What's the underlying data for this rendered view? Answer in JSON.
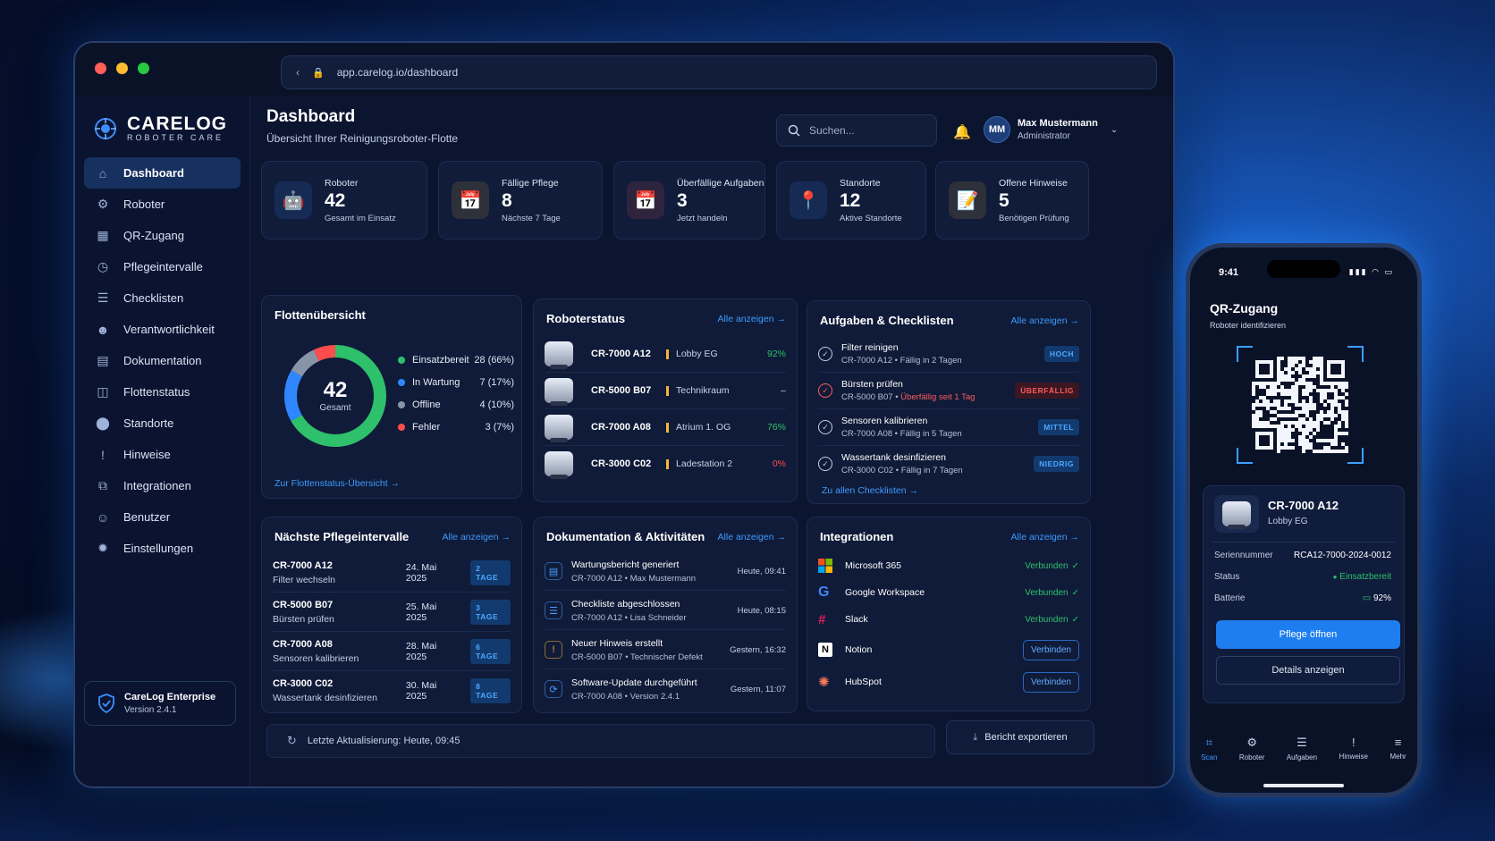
{
  "browser": {
    "url": "app.carelog.io/dashboard"
  },
  "brand": {
    "name": "CARELOG",
    "tagline": "ROBOTER CARE"
  },
  "sidebar": {
    "items": [
      {
        "label": "Dashboard",
        "icon": "home-icon"
      },
      {
        "label": "Roboter",
        "icon": "robot-icon"
      },
      {
        "label": "QR-Zugang",
        "icon": "qr-icon"
      },
      {
        "label": "Pflegeintervalle",
        "icon": "clock-icon"
      },
      {
        "label": "Checklisten",
        "icon": "checklist-icon"
      },
      {
        "label": "Verantwortlichkeit",
        "icon": "users-icon"
      },
      {
        "label": "Dokumentation",
        "icon": "document-icon"
      },
      {
        "label": "Flottenstatus",
        "icon": "fleet-icon"
      },
      {
        "label": "Standorte",
        "icon": "location-icon"
      },
      {
        "label": "Hinweise",
        "icon": "alert-icon"
      },
      {
        "label": "Integrationen",
        "icon": "integration-icon"
      },
      {
        "label": "Benutzer",
        "icon": "user-icon"
      },
      {
        "label": "Einstellungen",
        "icon": "settings-icon"
      }
    ],
    "enterprise": {
      "title": "CareLog Enterprise",
      "version": "Version 2.4.1"
    }
  },
  "header": {
    "title": "Dashboard",
    "subtitle": "Übersicht Ihrer Reinigungsroboter-Flotte",
    "search_placeholder": "Suchen...",
    "user": {
      "initials": "MM",
      "name": "Max Mustermann",
      "role": "Administrator"
    }
  },
  "stats": [
    {
      "label": "Roboter",
      "value": "42",
      "sub": "Gesamt im Einsatz",
      "color": "#3d8dff"
    },
    {
      "label": "Fällige Pflege",
      "value": "8",
      "sub": "Nächste 7 Tage",
      "color": "#f5b63b"
    },
    {
      "label": "Überfällige Aufgaben",
      "value": "3",
      "sub": "Jetzt handeln",
      "color": "#ff5a5a"
    },
    {
      "label": "Standorte",
      "value": "12",
      "sub": "Aktive Standorte",
      "color": "#3d8dff"
    },
    {
      "label": "Offene Hinweise",
      "value": "5",
      "sub": "Benötigen Prüfung",
      "color": "#f5b63b"
    }
  ],
  "fleet": {
    "title": "Flottenübersicht",
    "total": "42",
    "total_label": "Gesamt",
    "link": "Zur Flottenstatus-Übersicht →",
    "segments": [
      {
        "label": "Einsatzbereit",
        "value": "28 (66%)",
        "count": 28,
        "color": "#2fc06c"
      },
      {
        "label": "In Wartung",
        "value": "7 (17%)",
        "count": 7,
        "color": "#2f86ff"
      },
      {
        "label": "Offline",
        "value": "4 (10%)",
        "count": 4,
        "color": "#8a94a8"
      },
      {
        "label": "Fehler",
        "value": "3 (7%)",
        "count": 3,
        "color": "#ff4d4d"
      }
    ]
  },
  "robot_status": {
    "title": "Roboterstatus",
    "link": "Alle anzeigen →",
    "rows": [
      {
        "id": "CR-7000 A12",
        "location": "Lobby EG",
        "battery": "92%",
        "color": "#2fc06c"
      },
      {
        "id": "CR-5000 B07",
        "location": "Technikraum",
        "battery": "–",
        "color": "#c4cfe5"
      },
      {
        "id": "CR-7000 A08",
        "location": "Atrium 1. OG",
        "battery": "76%",
        "color": "#2fc06c"
      },
      {
        "id": "CR-3000 C02",
        "location": "Ladestation 2",
        "battery": "0%",
        "color": "#ff4d4d"
      }
    ]
  },
  "tasks": {
    "title": "Aufgaben & Checklisten",
    "link": "Alle anzeigen →",
    "footer_link": "Zu allen Checklisten →",
    "rows": [
      {
        "title": "Filter reinigen",
        "robot": "CR-7000 A12",
        "due": "Fällig in 2 Tagen",
        "badge": "HOCH",
        "overdue": false
      },
      {
        "title": "Bürsten prüfen",
        "robot": "CR-5000 B07",
        "due": "Überfällig seit 1 Tag",
        "badge": "ÜBERFÄLLIG",
        "overdue": true
      },
      {
        "title": "Sensoren kalibrieren",
        "robot": "CR-7000 A08",
        "due": "Fällig in 5 Tagen",
        "badge": "MITTEL",
        "overdue": false
      },
      {
        "title": "Wassertank desinfizieren",
        "robot": "CR-3000 C02",
        "due": "Fällig in 7 Tagen",
        "badge": "NIEDRIG",
        "overdue": false
      }
    ]
  },
  "intervals": {
    "title": "Nächste Pflegeintervalle",
    "link": "Alle anzeigen →",
    "rows": [
      {
        "robot": "CR-7000 A12",
        "task": "Filter wechseln",
        "date": "24. Mai 2025",
        "badge": "2 TAGE"
      },
      {
        "robot": "CR-5000 B07",
        "task": "Bürsten prüfen",
        "date": "25. Mai 2025",
        "badge": "3 TAGE"
      },
      {
        "robot": "CR-7000 A08",
        "task": "Sensoren kalibrieren",
        "date": "28. Mai 2025",
        "badge": "6 TAGE"
      },
      {
        "robot": "CR-3000 C02",
        "task": "Wassertank desinfizieren",
        "date": "30. Mai 2025",
        "badge": "8 TAGE"
      }
    ]
  },
  "activities": {
    "title": "Dokumentation & Aktivitäten",
    "link": "Alle anzeigen →",
    "rows": [
      {
        "title": "Wartungsbericht generiert",
        "meta": "CR-7000 A12 • Max Mustermann",
        "time": "Heute, 09:41",
        "icon": "document-icon"
      },
      {
        "title": "Checkliste abgeschlossen",
        "meta": "CR-7000 A12 • Lisa Schneider",
        "time": "Heute, 08:15",
        "icon": "checklist-icon"
      },
      {
        "title": "Neuer Hinweis erstellt",
        "meta": "CR-5000 B07 • Technischer Defekt",
        "time": "Gestern, 16:32",
        "icon": "alert-icon"
      },
      {
        "title": "Software-Update durchgeführt",
        "meta": "CR-7000 A08 • Version 2.4.1",
        "time": "Gestern, 11:07",
        "icon": "update-icon"
      }
    ]
  },
  "integrations": {
    "title": "Integrationen",
    "link": "Alle anzeigen →",
    "rows": [
      {
        "name": "Microsoft 365",
        "status": "Verbunden",
        "connected": true
      },
      {
        "name": "Google Workspace",
        "status": "Verbunden",
        "connected": true
      },
      {
        "name": "Slack",
        "status": "Verbunden",
        "connected": true
      },
      {
        "name": "Notion",
        "status": "Verbinden",
        "connected": false
      },
      {
        "name": "HubSpot",
        "status": "Verbinden",
        "connected": false
      }
    ]
  },
  "footer": {
    "last_update": "Letzte Aktualisierung: Heute, 09:45",
    "export": "Bericht exportieren"
  },
  "phone": {
    "time": "9:41",
    "title": "QR-Zugang",
    "subtitle": "Roboter identifizieren",
    "robot": "CR-7000 A12",
    "location": "Lobby EG",
    "serial_label": "Seriennummer",
    "serial": "RCA12-7000-2024-0012",
    "status_label": "Status",
    "status": "Einsatzbereit",
    "battery_label": "Batterie",
    "battery": "92%",
    "primary_button": "Pflege öffnen",
    "secondary_button": "Details anzeigen",
    "tabs": [
      "Scan",
      "Roboter",
      "Aufgaben",
      "Hinweise",
      "Mehr"
    ]
  }
}
